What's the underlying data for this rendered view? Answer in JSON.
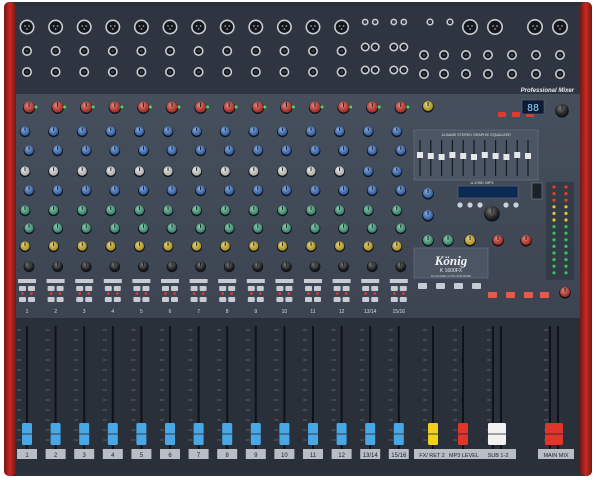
{
  "brand": {
    "name": "König",
    "model": "K 1600FX",
    "subtitle": "16 CHANNEL ULTRA SLIM MIXER",
    "tagline": "Professional Mixer"
  },
  "channel_strip_labels": [
    "1",
    "2",
    "3",
    "4",
    "5",
    "6",
    "7",
    "8",
    "9",
    "10",
    "11",
    "12",
    "13/14",
    "15/16"
  ],
  "master_labels": {
    "fx_ret": "FX/ RET 2",
    "mp3_level": "MP3 LEVEL",
    "sub": "SUB 1-2",
    "main": "MAIN MIX"
  },
  "eq_title": "11-BAND STEREO GRAPHIC EQUALIZER",
  "mp3_title": "U-DISK MP3",
  "display_value": "88",
  "colors": {
    "panel": "#3d4653",
    "panel_dark": "#262c35",
    "side": "#b3231f",
    "knob_gain": "#d8352a",
    "knob_blue": "#3d7ad6",
    "knob_white": "#e9e9e9",
    "knob_green": "#46b08a",
    "knob_yellow": "#e2c22a",
    "knob_black": "#1a1a1a",
    "fader_blue": "#4aa7e6",
    "fader_yellow": "#f0d21c",
    "fader_red": "#e0352b",
    "fader_white": "#f2f2f2"
  }
}
